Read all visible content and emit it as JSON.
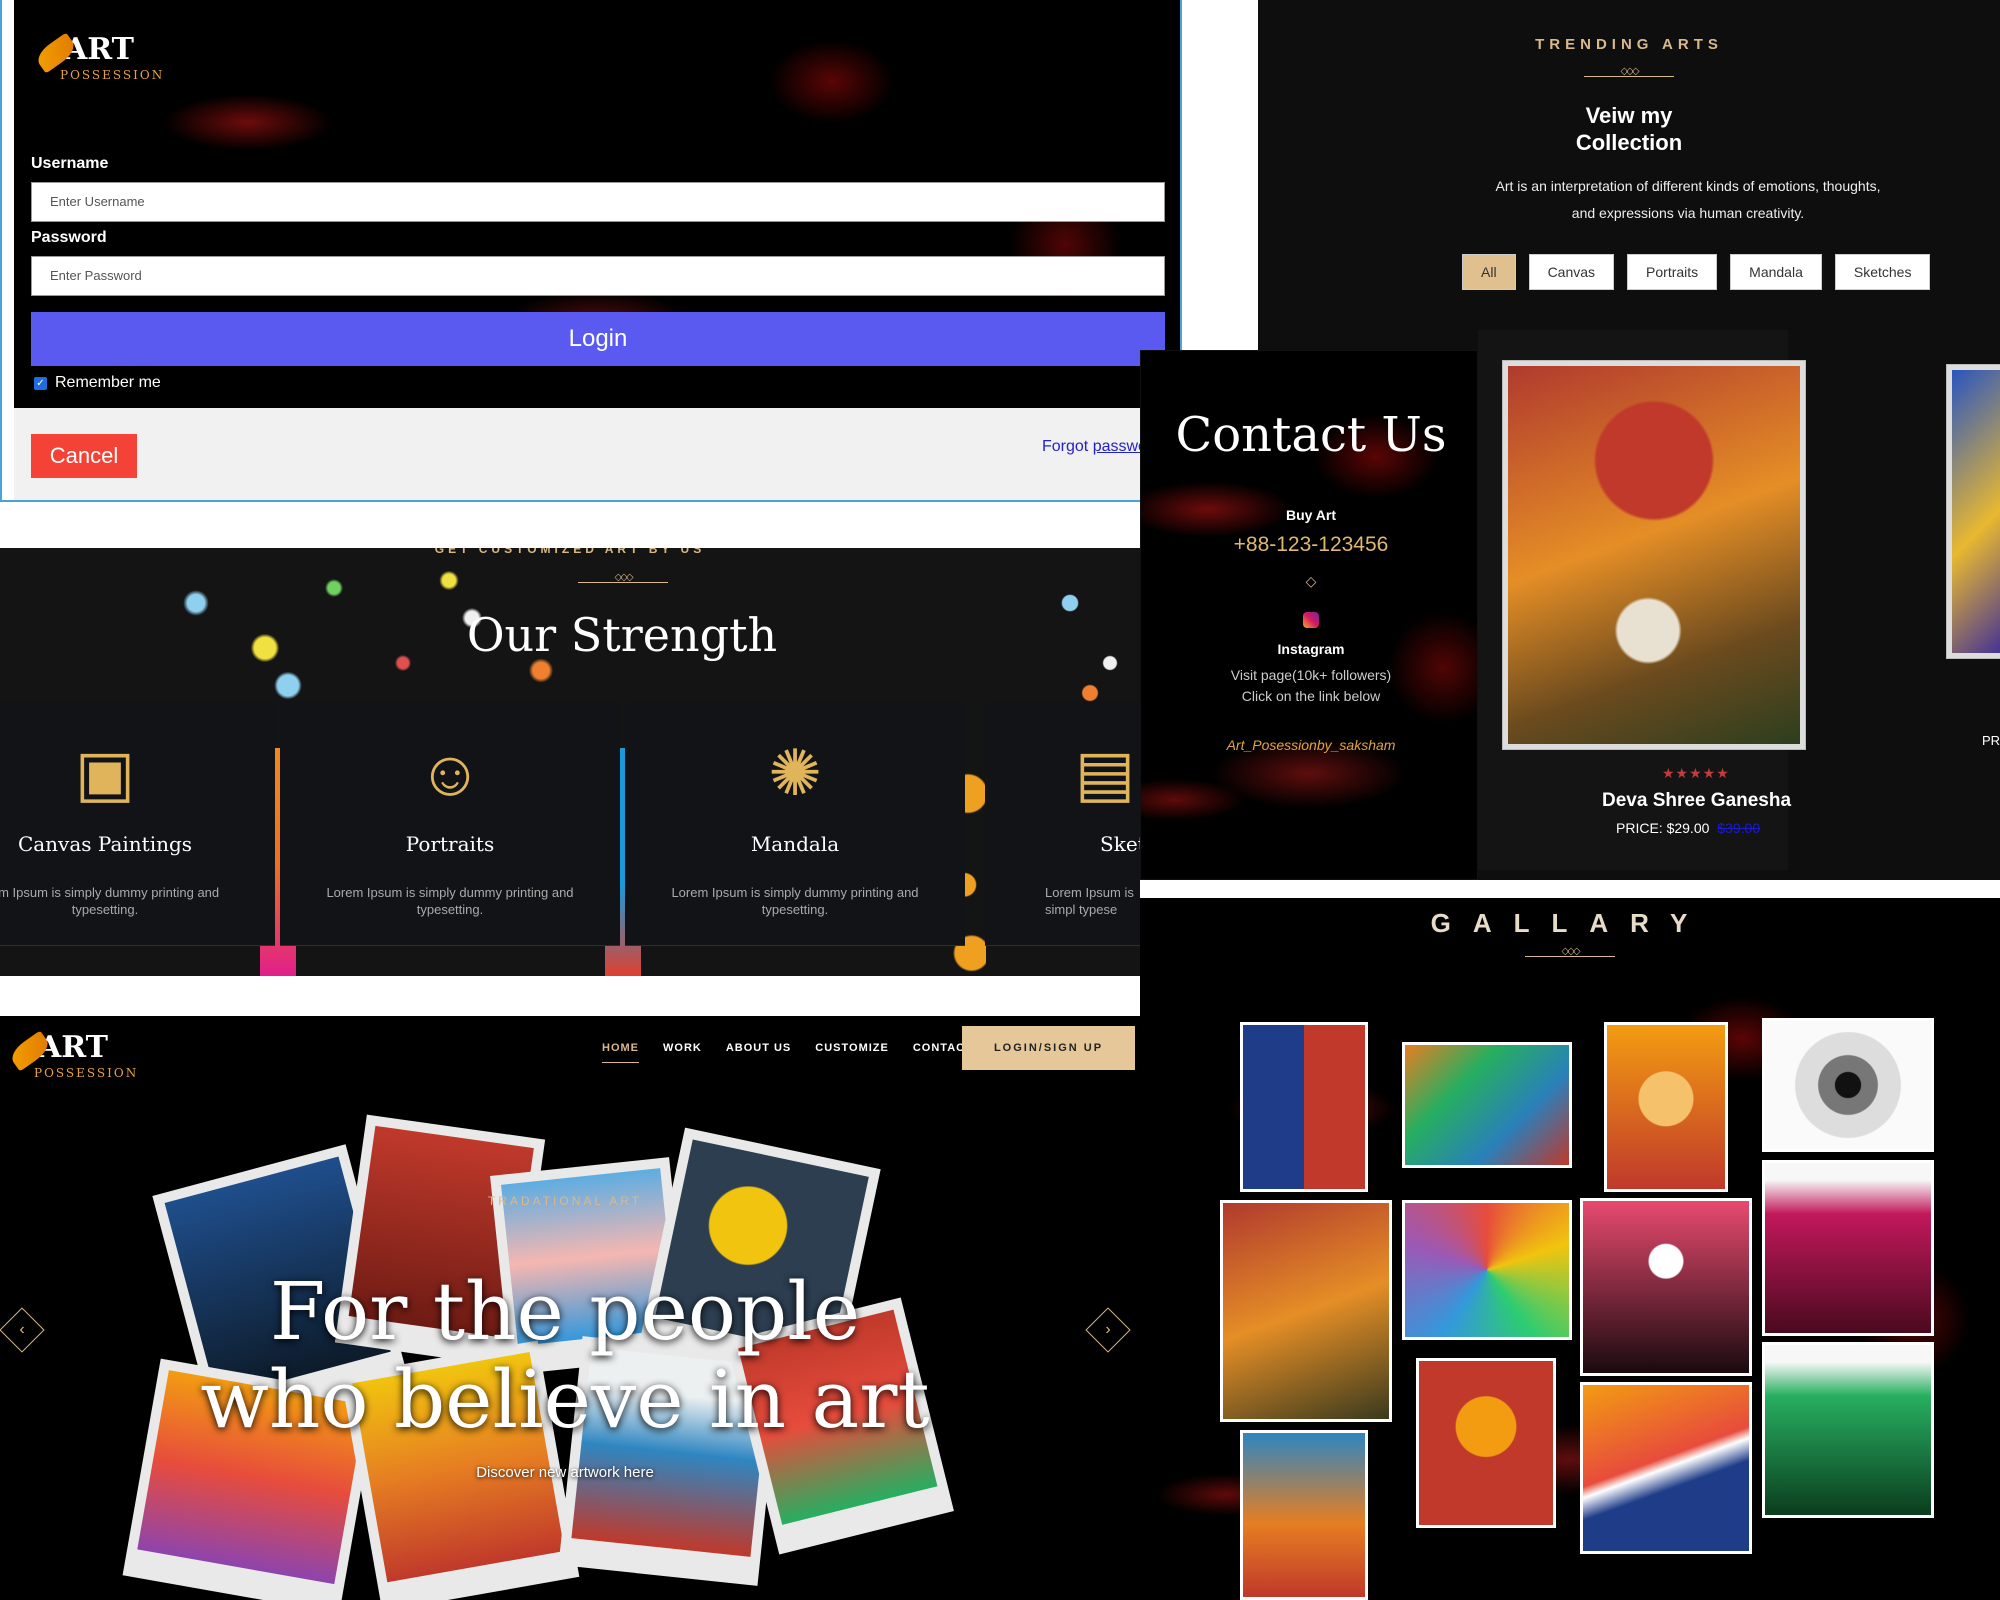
{
  "login": {
    "logo_art": "ART",
    "logo_sub": "POSSESSION",
    "username_label": "Username",
    "username_placeholder": "Enter Username",
    "password_label": "Password",
    "password_placeholder": "Enter Password",
    "login_button": "Login",
    "remember_label": "Remember me",
    "cancel_button": "Cancel",
    "forgot_prefix": "Forgot",
    "forgot_link": "passwo"
  },
  "trending": {
    "eyebrow": "TRENDING ARTS",
    "title_line1": "Veiw my",
    "title_line2": "Collection",
    "desc_line1": "Art is an interpretation of different kinds of emotions, thoughts,",
    "desc_line2": "and expressions via human creativity.",
    "filters": [
      "All",
      "Canvas",
      "Portraits",
      "Mandala",
      "Sketches"
    ],
    "active_filter": "All",
    "product_name": "Deva Shree Ganesha",
    "stars": "★★★★★",
    "price_label": "PRICE:",
    "price": "$29.00",
    "old_price": "$39.00",
    "next_price_label": "PR"
  },
  "contact": {
    "title": "Contact Us",
    "buy_label": "Buy Art",
    "phone": "+88-123-123456",
    "diamond": "◇",
    "instagram_label": "Instagram",
    "visit_text": "Visit page(10k+ followers)",
    "click_text": "Click on the link below",
    "handle": "Art_Posessionby_saksham"
  },
  "strength": {
    "eyebrow": "GET CUSTOMIZED ART BY US",
    "title": "Our Strength",
    "cards": [
      {
        "name": "Canvas Paintings",
        "desc": "Lorem Ipsum is simply dummy printing and typesetting.",
        "icon": "easel-icon"
      },
      {
        "name": "Portraits",
        "desc": "Lorem Ipsum is simply dummy printing and typesetting.",
        "icon": "portrait-icon"
      },
      {
        "name": "Mandala",
        "desc": "Lorem Ipsum is simply dummy printing and typesetting.",
        "icon": "mandala-icon"
      },
      {
        "name": "Sket",
        "desc": "Lorem Ipsum is simpl typese",
        "icon": "sketchbook-icon"
      }
    ],
    "card1_desc_visible": "em Ipsum is simply dummy printing and typesetting."
  },
  "gallery": {
    "title": "GALLARY"
  },
  "hero": {
    "logo_art": "ART",
    "logo_sub": "POSSESSION",
    "nav": [
      "HOME",
      "WORK",
      "ABOUT US",
      "CUSTOMIZE",
      "CONTACT"
    ],
    "signup_button": "LOGIN/SIGN UP",
    "eyebrow": "TRADATIONAL ART",
    "title_line1": "For the people",
    "title_line2": "who believe in art",
    "subtitle": "Discover new artwork here",
    "prev_icon": "chevron-left-icon",
    "next_icon": "chevron-right-icon"
  },
  "colors": {
    "gold": "#d9b98a",
    "login_blue": "#5a5af0",
    "cancel_red": "#f44336"
  }
}
